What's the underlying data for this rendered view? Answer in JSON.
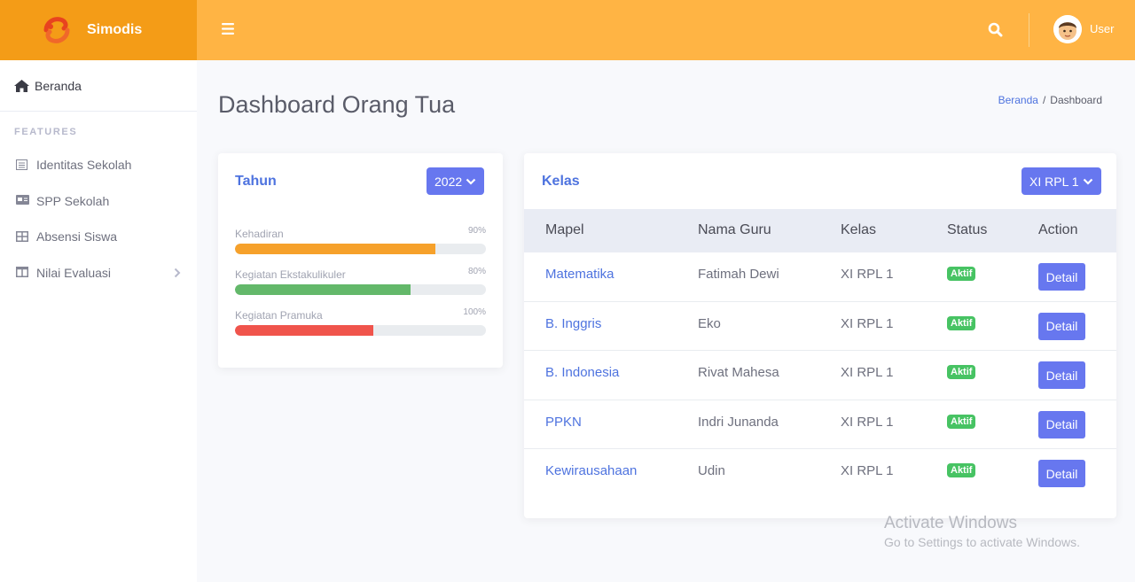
{
  "brand": {
    "name": "Simodis"
  },
  "sidebar": {
    "home_label": "Beranda",
    "heading": "FEATURES",
    "items": [
      {
        "label": "Identitas Sekolah",
        "icon": "list-icon"
      },
      {
        "label": "SPP Sekolah",
        "icon": "card-icon"
      },
      {
        "label": "Absensi Siswa",
        "icon": "table-icon"
      },
      {
        "label": "Nilai Evaluasi",
        "icon": "columns-icon"
      }
    ]
  },
  "topbar": {
    "user_name": "User"
  },
  "page": {
    "title": "Dashboard Orang Tua",
    "breadcrumb": {
      "home": "Beranda",
      "separator": "/",
      "current": "Dashboard"
    }
  },
  "year_card": {
    "title": "Tahun",
    "selected_year": "2022",
    "progress": [
      {
        "label": "Kehadiran",
        "percent_label": "90%",
        "fill": 0.8,
        "color": "#f6a12b"
      },
      {
        "label": "Kegiatan Ekstakulikuler",
        "percent_label": "80%",
        "fill": 0.7,
        "color": "#63b86a"
      },
      {
        "label": "Kegiatan Pramuka",
        "percent_label": "100%",
        "fill": 0.55,
        "color": "#f0544c"
      }
    ]
  },
  "class_card": {
    "title": "Kelas",
    "selected_class": "XI RPL 1",
    "headers": {
      "mapel": "Mapel",
      "guru": "Nama Guru",
      "kelas": "Kelas",
      "status": "Status",
      "action": "Action"
    },
    "rows": [
      {
        "mapel": "Matematika",
        "guru": "Fatimah Dewi",
        "kelas": "XI RPL 1",
        "status": "Aktif",
        "action": "Detail"
      },
      {
        "mapel": "B. Inggris",
        "guru": "Eko",
        "kelas": "XI RPL 1",
        "status": "Aktif",
        "action": "Detail"
      },
      {
        "mapel": "B. Indonesia",
        "guru": "Rivat Mahesa",
        "kelas": "XI RPL 1",
        "status": "Aktif",
        "action": "Detail"
      },
      {
        "mapel": "PPKN",
        "guru": "Indri Junanda",
        "kelas": "XI RPL 1",
        "status": "Aktif",
        "action": "Detail"
      },
      {
        "mapel": "Kewirausahaan",
        "guru": "Udin",
        "kelas": "XI RPL 1",
        "status": "Aktif",
        "action": "Detail"
      }
    ]
  },
  "watermark": {
    "line1": "Activate Windows",
    "line2": "Go to Settings to activate Windows."
  },
  "colors": {
    "brand": "#f49c17",
    "topbar": "#ffb444",
    "primary": "#6777ef",
    "link": "#4e73df",
    "success": "#47c363"
  }
}
